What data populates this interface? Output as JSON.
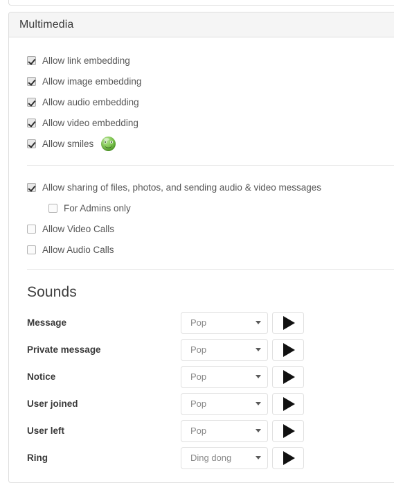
{
  "panel": {
    "title": "Multimedia"
  },
  "multimedia": {
    "options": [
      {
        "label": "Allow link embedding",
        "checked": true,
        "indent": false,
        "icon": null
      },
      {
        "label": "Allow image embedding",
        "checked": true,
        "indent": false,
        "icon": null
      },
      {
        "label": "Allow audio embedding",
        "checked": true,
        "indent": false,
        "icon": null
      },
      {
        "label": "Allow video embedding",
        "checked": true,
        "indent": false,
        "icon": null
      },
      {
        "label": "Allow smiles",
        "checked": true,
        "indent": false,
        "icon": "green-smiley-icon"
      }
    ],
    "options_group2": [
      {
        "label": "Allow sharing of files, photos, and sending audio & video messages",
        "checked": true,
        "indent": false
      },
      {
        "label": "For Admins only",
        "checked": false,
        "indent": true
      },
      {
        "label": "Allow Video Calls",
        "checked": false,
        "indent": false
      },
      {
        "label": "Allow Audio Calls",
        "checked": false,
        "indent": false
      }
    ]
  },
  "sounds": {
    "heading": "Sounds",
    "play_icon": "play-icon",
    "caret_icon": "chevron-down-icon",
    "rows": [
      {
        "label": "Message",
        "value": "Pop"
      },
      {
        "label": "Private message",
        "value": "Pop"
      },
      {
        "label": "Notice",
        "value": "Pop"
      },
      {
        "label": "User joined",
        "value": "Pop"
      },
      {
        "label": "User left",
        "value": "Pop"
      },
      {
        "label": "Ring",
        "value": "Ding dong"
      }
    ]
  },
  "colors": {
    "panel_border": "#dddddd",
    "heading_bg": "#f5f5f5",
    "label_text": "#555555",
    "bold_text": "#3a3a3a",
    "select_border": "#e0e0e0",
    "smiley_green": "#5fae33"
  }
}
